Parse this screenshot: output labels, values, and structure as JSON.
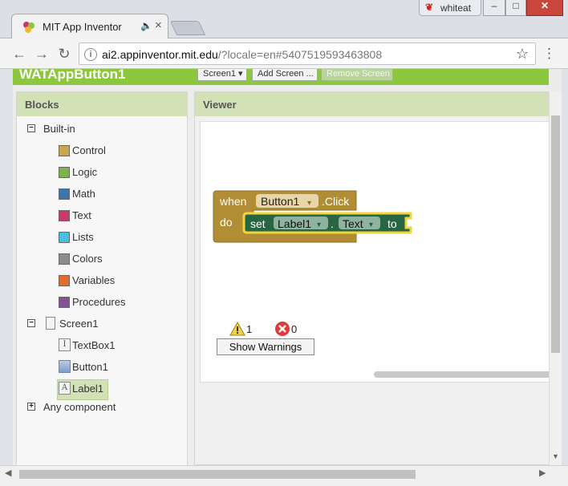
{
  "browser": {
    "tab_title": "MIT App Inventor",
    "user_name": "whiteat",
    "url_host": "ai2.appinventor.mit.edu",
    "url_rest": "/?locale=en#5407519593463808",
    "audio_icon": "speaker-icon",
    "close_glyph": "×",
    "back_glyph": "←",
    "forward_glyph": "→",
    "reload_glyph": "↻",
    "star_glyph": "☆",
    "menu_glyph": "⋮",
    "min_glyph": "–",
    "max_glyph": "□",
    "win_close_glyph": "✕"
  },
  "app": {
    "project_title": "WATAppButton1",
    "screen_dropdown": "Screen1 ▾",
    "add_screen": "Add Screen ...",
    "remove_screen": "Remove Screen",
    "header_color": "#8dc63f"
  },
  "blocks_panel": {
    "title": "Blocks",
    "built_in": {
      "toggle": "−",
      "label": "Built-in",
      "items": [
        {
          "label": "Control",
          "color": "#c8a64c"
        },
        {
          "label": "Logic",
          "color": "#7fb04c"
        },
        {
          "label": "Math",
          "color": "#3e74b2"
        },
        {
          "label": "Text",
          "color": "#c93a6a"
        },
        {
          "label": "Lists",
          "color": "#4fbbe0"
        },
        {
          "label": "Colors",
          "color": "#8c8c8c"
        },
        {
          "label": "Variables",
          "color": "#e26b2e"
        },
        {
          "label": "Procedures",
          "color": "#7e5394"
        }
      ]
    },
    "screen": {
      "toggle": "−",
      "label": "Screen1",
      "components": [
        {
          "label": "TextBox1",
          "icon": "textbox-icon",
          "glyph": "I"
        },
        {
          "label": "Button1",
          "icon": "button-icon",
          "glyph": ""
        },
        {
          "label": "Label1",
          "icon": "label-icon",
          "glyph": "A"
        }
      ]
    },
    "any_component": {
      "toggle": "+",
      "label": "Any component"
    }
  },
  "viewer": {
    "title": "Viewer",
    "event_block": {
      "keyword_when": "when",
      "component": "Button1",
      "event": ".Click",
      "keyword_do": "do",
      "color": "#b18e35"
    },
    "set_block": {
      "keyword_set": "set",
      "component": "Label1",
      "dot": ".",
      "property": "Text",
      "keyword_to": "to",
      "color": "#266643"
    },
    "dropdown_arrow": "▾",
    "warnings_count": "1",
    "errors_count": "0",
    "show_warnings": "Show Warnings"
  }
}
